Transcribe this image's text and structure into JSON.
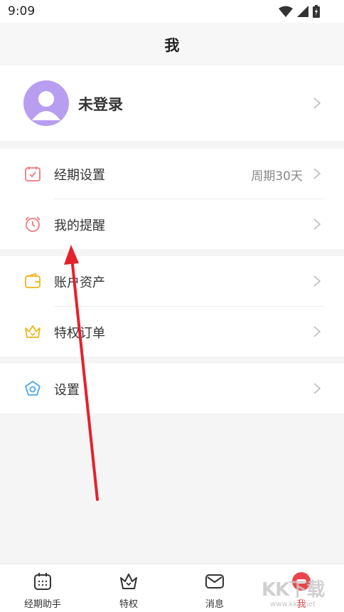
{
  "status": {
    "time": "9:09"
  },
  "header": {
    "title": "我"
  },
  "profile": {
    "name": "未登录"
  },
  "groups": [
    [
      {
        "icon": "calendar-check-icon",
        "label": "经期设置",
        "value": "周期30天"
      },
      {
        "icon": "alarm-clock-icon",
        "label": "我的提醒",
        "value": ""
      }
    ],
    [
      {
        "icon": "wallet-icon",
        "label": "账户资产",
        "value": ""
      },
      {
        "icon": "crown-icon",
        "label": "特权订单",
        "value": ""
      }
    ],
    [
      {
        "icon": "settings-pentagon-icon",
        "label": "设置",
        "value": ""
      }
    ]
  ],
  "tabs": [
    {
      "label": "经期助手",
      "icon": "calendar-grid-icon",
      "active": false
    },
    {
      "label": "特权",
      "icon": "crown-icon",
      "active": false
    },
    {
      "label": "消息",
      "icon": "mail-icon",
      "active": false
    },
    {
      "label": "我",
      "icon": "profile-icon",
      "active": true
    }
  ],
  "watermark": {
    "text": "KK下载",
    "url": "www.kkx.net"
  },
  "colors": {
    "accent": "#e8454b",
    "avatar": "#b79ef0",
    "pink_icon": "#f07a7a",
    "yellow_icon": "#f2b41c",
    "blue_icon": "#4aa6e8"
  }
}
